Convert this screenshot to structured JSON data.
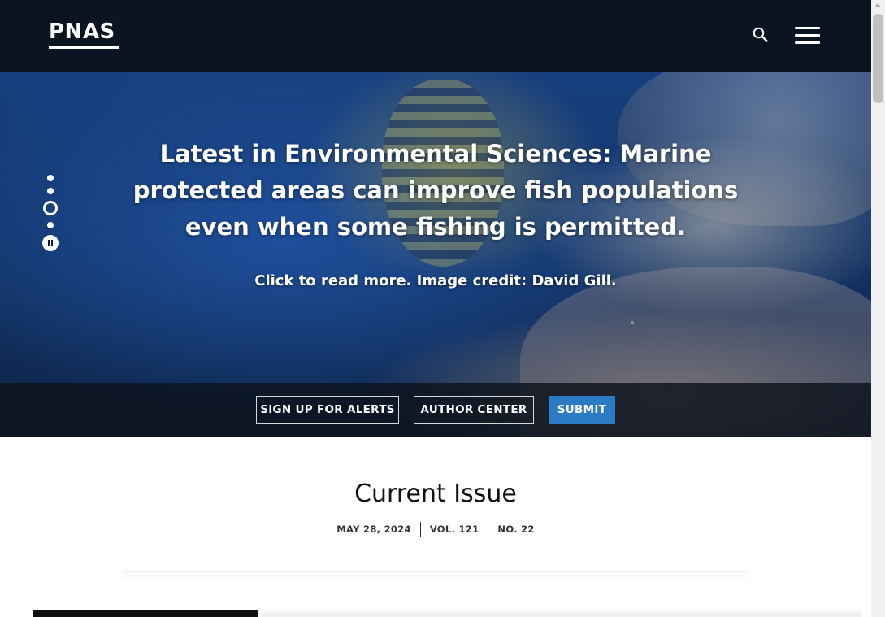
{
  "header": {
    "logo": "PNAS",
    "search_icon": "search-icon",
    "menu_icon": "hamburger-menu-icon"
  },
  "hero": {
    "headline": "Latest in Environmental Sciences: Marine protected areas can improve fish populations even when some fishing is permitted.",
    "subtext": "Click to read more. Image credit: David Gill.",
    "carousel": {
      "slide_count": 4,
      "active_slide": 3,
      "pause_icon": "pause-icon"
    },
    "actions": {
      "alerts": "SIGN UP FOR ALERTS",
      "author_center": "AUTHOR CENTER",
      "submit": "SUBMIT"
    }
  },
  "current_issue": {
    "title": "Current Issue",
    "date": "MAY 28, 2024",
    "volume": "VOL. 121",
    "number": "NO. 22"
  },
  "colors": {
    "header_bg": "#0b1522",
    "primary_button": "#2a7bc4",
    "hero_blue": "#173f7f"
  }
}
